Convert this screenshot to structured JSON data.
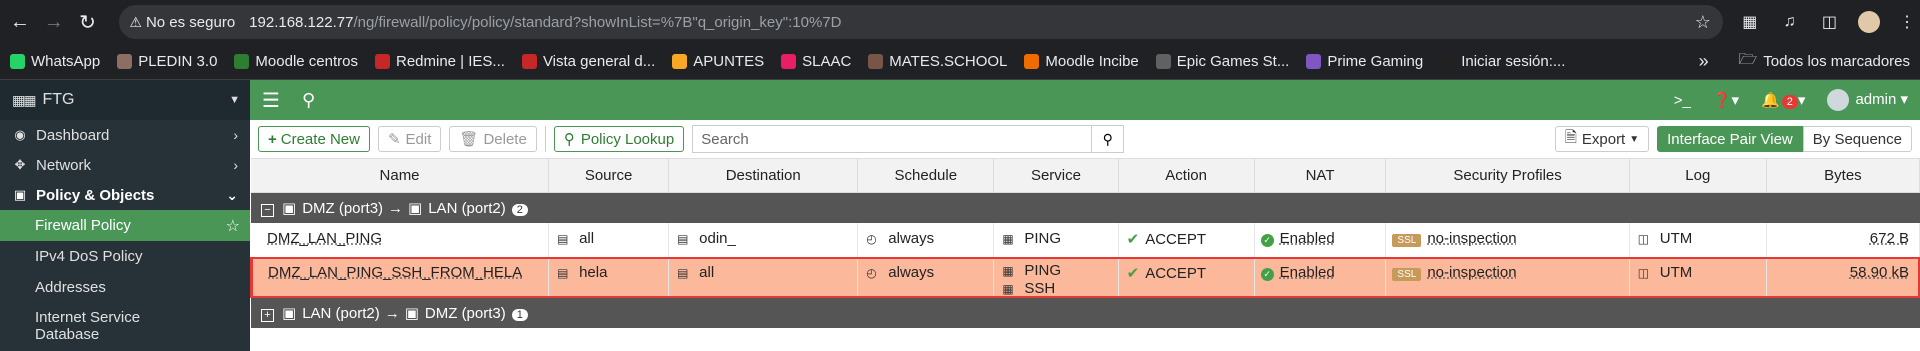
{
  "browser": {
    "security_label": "No es seguro",
    "url_host": "192.168.122.77",
    "url_path": "/ng/firewall/policy/policy/standard?showInList=%7B\"q_origin_key\":10%7D"
  },
  "bookmarks": [
    {
      "label": "WhatsApp",
      "color": "#25d366"
    },
    {
      "label": "PLEDIN 3.0",
      "color": "#8d6e63"
    },
    {
      "label": "Moodle centros",
      "color": "#2e7d32"
    },
    {
      "label": "Redmine | IES...",
      "color": "#c62828"
    },
    {
      "label": "Vista general d...",
      "color": "#c62828"
    },
    {
      "label": "APUNTES",
      "color": "#f9a825"
    },
    {
      "label": "SLAAC",
      "color": "#e91e63"
    },
    {
      "label": "MATES.SCHOOL",
      "color": "#795548"
    },
    {
      "label": "Moodle Incibe",
      "color": "#ef6c00"
    },
    {
      "label": "Epic Games St...",
      "color": "#616161"
    },
    {
      "label": "Prime Gaming",
      "color": "#7e57c2"
    },
    {
      "label": "Iniciar sesión:...",
      "color": "#212121"
    }
  ],
  "bookmarks_all": "Todos los marcadores",
  "sidebar": {
    "device": "FTG",
    "items": [
      {
        "label": "Dashboard"
      },
      {
        "label": "Network"
      },
      {
        "label": "Policy & Objects"
      }
    ],
    "subitems": [
      {
        "label": "Firewall Policy"
      },
      {
        "label": "IPv4 DoS Policy"
      },
      {
        "label": "Addresses"
      },
      {
        "label": "Internet Service Database"
      }
    ]
  },
  "topbar": {
    "notifications": "2",
    "user": "admin"
  },
  "toolbar": {
    "create_new": "Create New",
    "edit": "Edit",
    "delete": "Delete",
    "policy_lookup": "Policy Lookup",
    "search_placeholder": "Search",
    "export": "Export",
    "interface_pair_view": "Interface Pair View",
    "by_sequence": "By Sequence"
  },
  "table": {
    "columns": [
      "Name",
      "Source",
      "Destination",
      "Schedule",
      "Service",
      "Action",
      "NAT",
      "Security Profiles",
      "Log",
      "Bytes"
    ],
    "group1": {
      "from": "DMZ (port3)",
      "to": "LAN (port2)",
      "count": "2"
    },
    "rows": [
      {
        "name": "DMZ_LAN_PING",
        "source": "all",
        "destination": "odin_",
        "schedule": "always",
        "service1": "PING",
        "service2": "",
        "action": "ACCEPT",
        "nat": "Enabled",
        "profile_tag": "SSL",
        "profile": "no-inspection",
        "log": "UTM",
        "bytes": "672 B"
      },
      {
        "name": "DMZ_LAN_PING_SSH_FROM_HELA",
        "source": "hela",
        "destination": "all",
        "schedule": "always",
        "service1": "PING",
        "service2": "SSH",
        "action": "ACCEPT",
        "nat": "Enabled",
        "profile_tag": "SSL",
        "profile": "no-inspection",
        "log": "UTM",
        "bytes": "58.90 kB"
      }
    ],
    "group2": {
      "from": "LAN (port2)",
      "to": "DMZ (port3)",
      "count": "1"
    }
  }
}
